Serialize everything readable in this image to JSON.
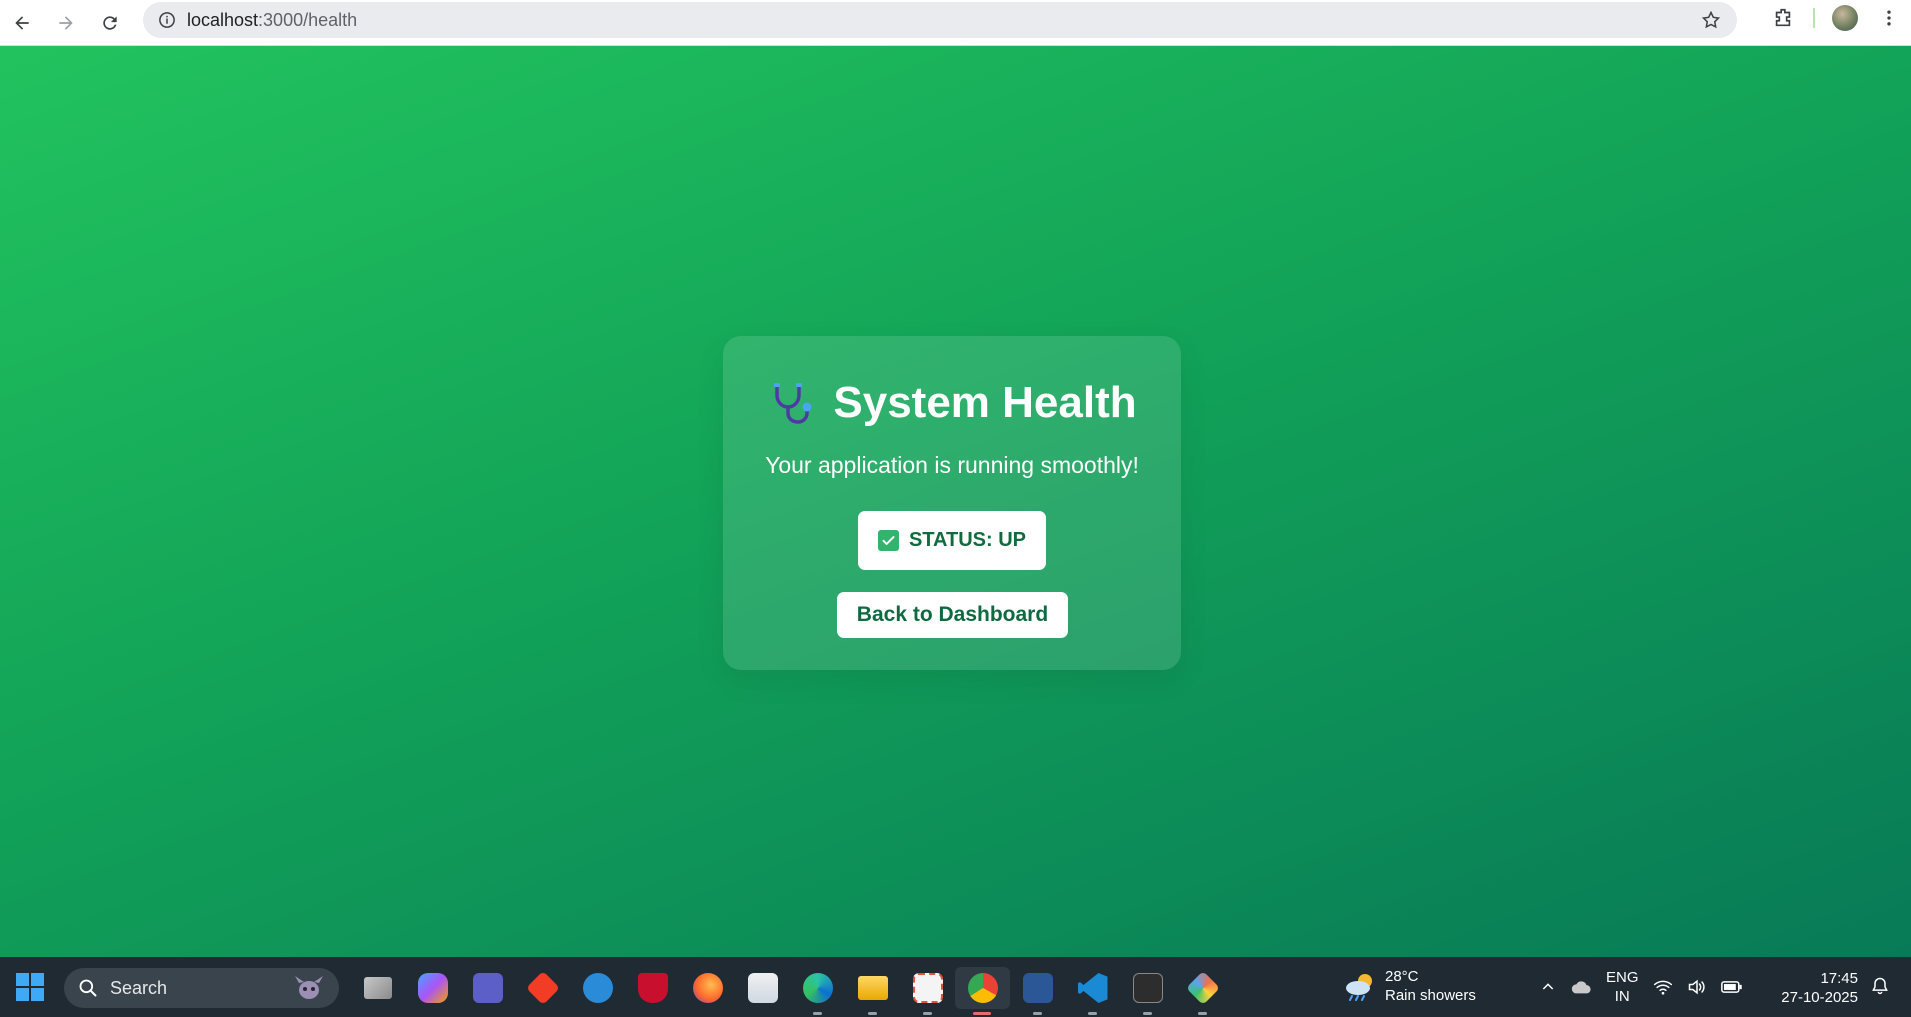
{
  "browser": {
    "url_host": "localhost",
    "url_path": ":3000/health"
  },
  "card": {
    "title": "System Health",
    "subtitle": "Your application is running smoothly!",
    "status_label": "STATUS: UP",
    "back_button_label": "Back to Dashboard"
  },
  "taskbar": {
    "search_placeholder": "Search",
    "weather_temp": "28°C",
    "weather_desc": "Rain showers",
    "lang_line1": "ENG",
    "lang_line2": "IN",
    "time": "17:45",
    "date": "27-10-2025",
    "apps": [
      "task-view",
      "copilot",
      "teams",
      "git-gui",
      "help",
      "mcafee",
      "firefox",
      "store",
      "edge",
      "file-explorer",
      "snipping-tool",
      "chrome",
      "word",
      "vscode",
      "terminal",
      "git-kraken"
    ]
  },
  "colors": {
    "bg_top": "#22c35e",
    "bg_bottom": "#087a57",
    "accent_text": "#116b3f"
  }
}
